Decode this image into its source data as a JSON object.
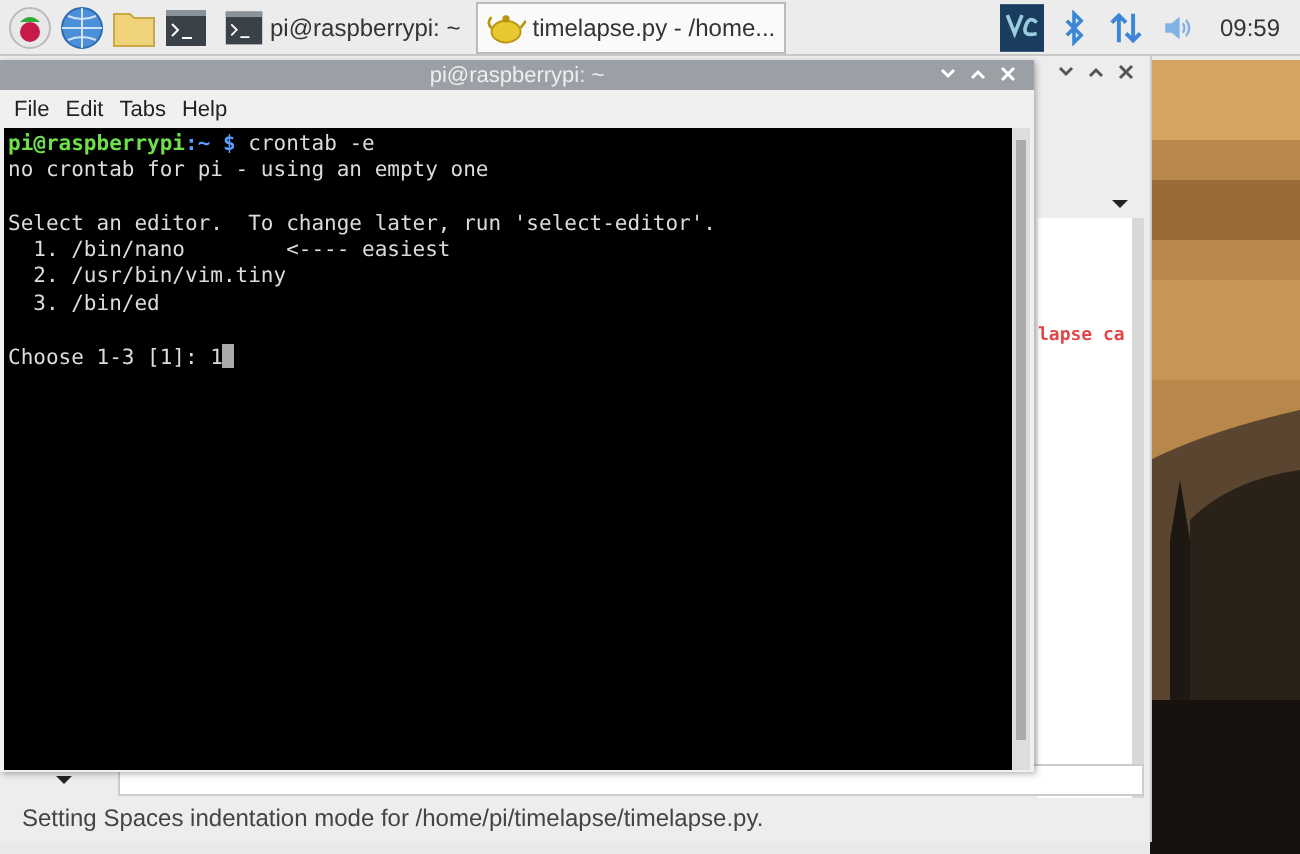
{
  "taskbar": {
    "launchers": [
      {
        "kind": "raspberry"
      },
      {
        "kind": "globe"
      },
      {
        "kind": "folder"
      },
      {
        "kind": "terminal"
      }
    ],
    "tasks": [
      {
        "kind": "terminal",
        "label": "pi@raspberrypi: ~",
        "selected": false
      },
      {
        "kind": "editor",
        "label": "timelapse.py - /home...",
        "selected": true
      }
    ],
    "clock": "09:59"
  },
  "editor_window": {
    "visible_code": "lapse ca",
    "status_bar": "Setting Spaces indentation mode for /home/pi/timelapse/timelapse.py."
  },
  "terminal_window": {
    "title": "pi@raspberrypi: ~",
    "menu": [
      "File",
      "Edit",
      "Tabs",
      "Help"
    ],
    "prompt_user": "pi@raspberrypi",
    "prompt_path": ":~ $",
    "command": " crontab -e",
    "output": [
      [
        "no crontab for pi - using an empty one"
      ],
      [
        "Select an editor.  To change later, run 'select-editor'.",
        "  1. /bin/nano        <---- easiest",
        "  2. /usr/bin/vim.tiny",
        "  3. /bin/ed"
      ],
      [
        "Choose 1-3 [1]: 1"
      ]
    ]
  }
}
